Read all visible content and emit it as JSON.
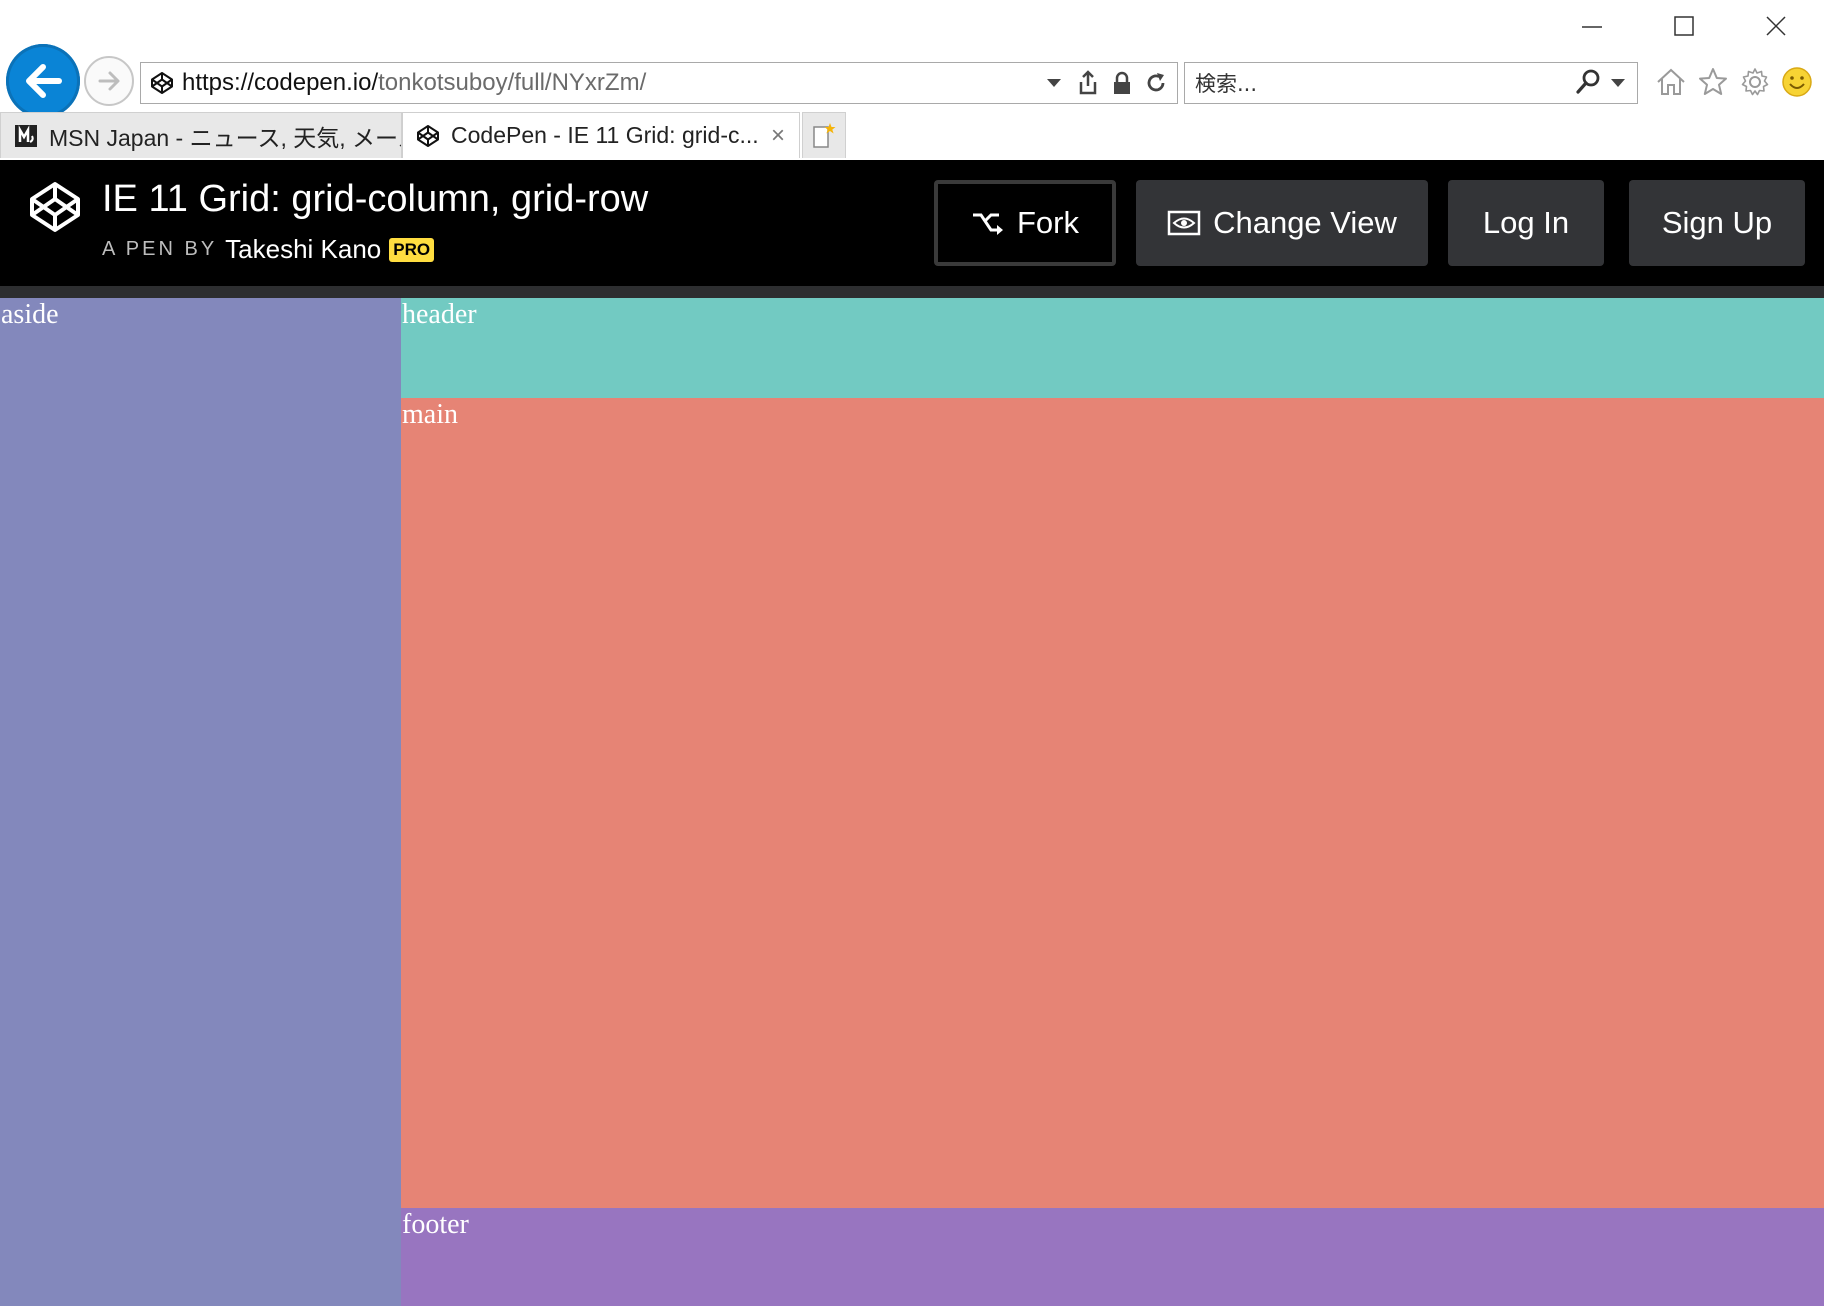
{
  "browser": {
    "address": {
      "url_host": "https://codepen.io/",
      "url_path": "tonkotsuboy/full/NYxrZm/"
    },
    "search": {
      "placeholder": "検索..."
    },
    "tabs": [
      {
        "label": "MSN Japan - ニュース, 天気, メール...",
        "icon": "msn-icon",
        "active": false
      },
      {
        "label": "CodePen - IE 11 Grid: grid-c...",
        "icon": "codepen-icon",
        "active": true,
        "close": "×"
      }
    ]
  },
  "codepen": {
    "title": "IE 11 Grid: grid-column, grid-row",
    "byline_prefix": "A PEN BY",
    "author": "Takeshi Kano",
    "badge": "PRO",
    "buttons": {
      "fork": "Fork",
      "change_view": "Change View",
      "login": "Log In",
      "signup": "Sign Up"
    }
  },
  "grid": {
    "aside": "aside",
    "header": "header",
    "main": "main",
    "footer": "footer"
  },
  "colors": {
    "aside": "#8388bc",
    "header": "#72cac2",
    "main": "#e68475",
    "footer": "#9875c0",
    "back_button": "#0a84d6",
    "pro_badge": "#ffdd40"
  }
}
